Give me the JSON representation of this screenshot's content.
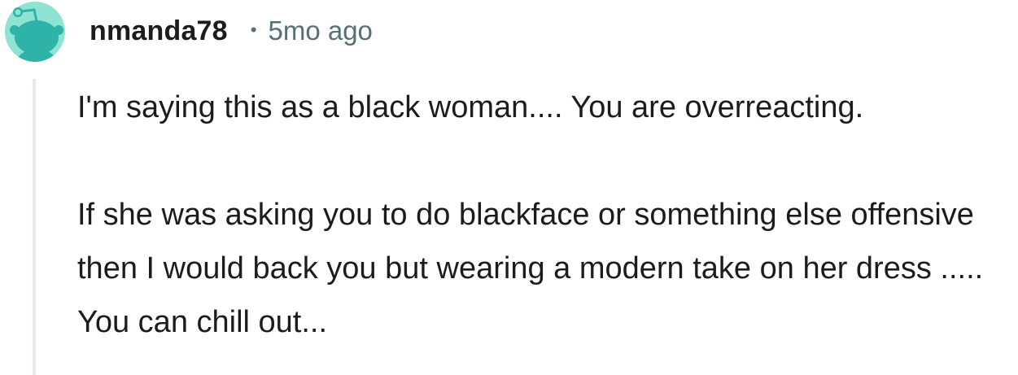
{
  "comment": {
    "author": "nmanda78",
    "separator": "•",
    "timestamp": "5mo ago",
    "avatar_icon": "reddit-snoo-avatar-icon",
    "colors": {
      "avatar_bg": "#8fe3d2",
      "snoo": "#2fb3a8",
      "meta": "#576f76",
      "thread_line": "#e5ebee"
    },
    "paragraphs": [
      "I'm saying this as a black woman.... You are overreacting.",
      "If she was asking you to do blackface or something else offensive then I would back you but wearing a modern take on her dress ..... You can chill out..."
    ]
  }
}
